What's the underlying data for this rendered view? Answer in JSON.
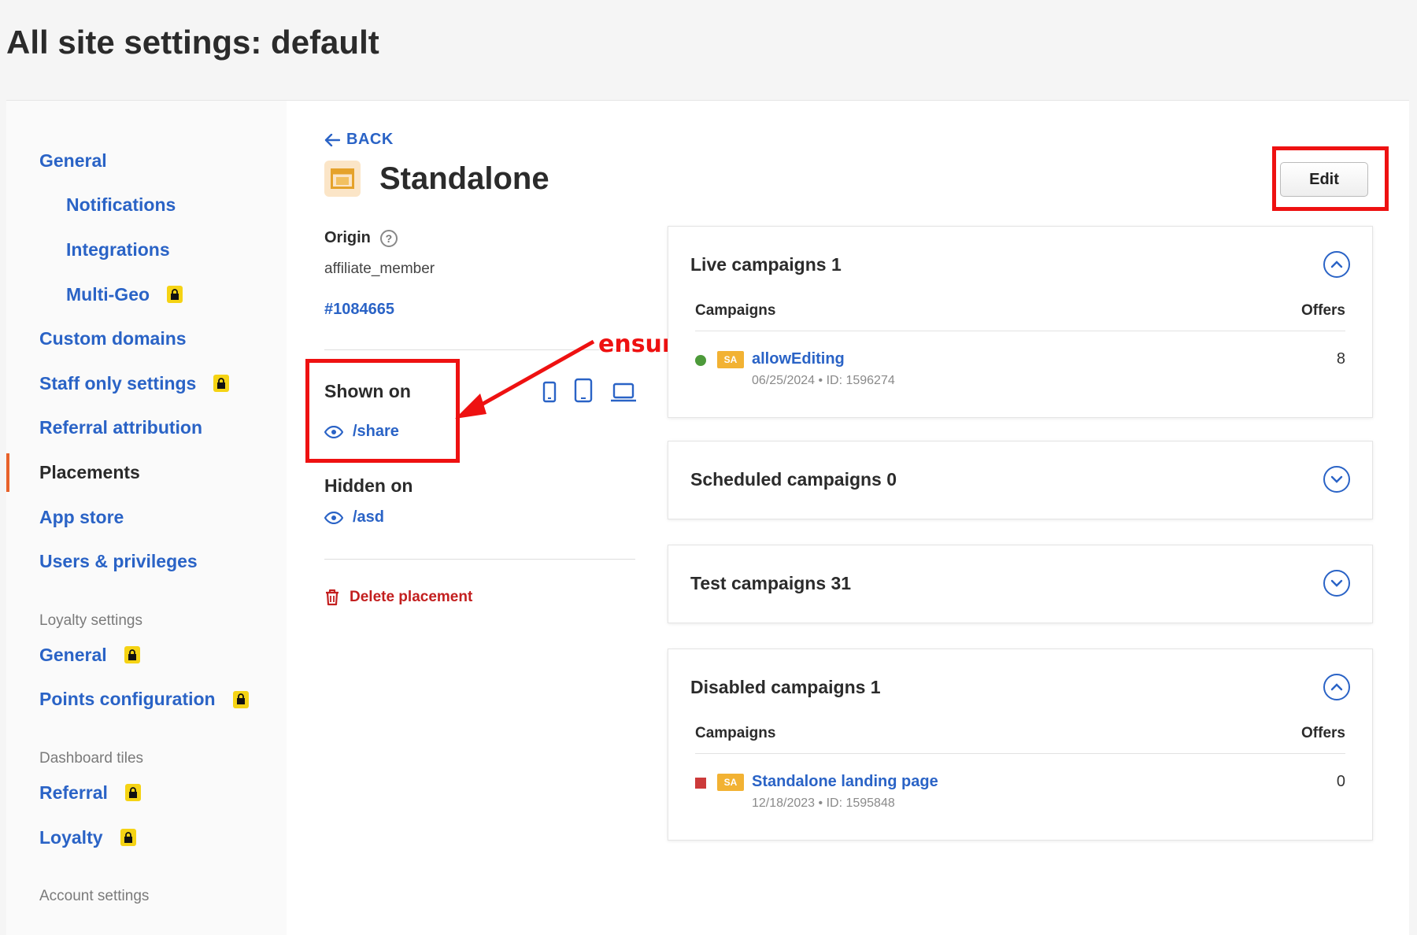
{
  "page": {
    "title": "All site settings: default"
  },
  "sidebar": {
    "items": [
      {
        "label": "General",
        "sub": false,
        "locked": false,
        "active": false
      },
      {
        "label": "Notifications",
        "sub": true,
        "locked": false,
        "active": false
      },
      {
        "label": "Integrations",
        "sub": true,
        "locked": false,
        "active": false
      },
      {
        "label": "Multi-Geo",
        "sub": true,
        "locked": true,
        "active": false
      },
      {
        "label": "Custom domains",
        "sub": false,
        "locked": false,
        "active": false
      },
      {
        "label": "Staff only settings",
        "sub": false,
        "locked": true,
        "active": false
      },
      {
        "label": "Referral attribution",
        "sub": false,
        "locked": false,
        "active": false
      },
      {
        "label": "Placements",
        "sub": false,
        "locked": false,
        "active": true
      },
      {
        "label": "App store",
        "sub": false,
        "locked": false,
        "active": false
      },
      {
        "label": "Users & privileges",
        "sub": false,
        "locked": false,
        "active": false
      }
    ],
    "loyalty_group": "Loyalty settings",
    "loyalty_items": [
      {
        "label": "General",
        "locked": true
      },
      {
        "label": "Points configuration",
        "locked": true
      }
    ],
    "dashboard_group": "Dashboard tiles",
    "dashboard_items": [
      {
        "label": "Referral",
        "locked": true
      },
      {
        "label": "Loyalty",
        "locked": true
      }
    ],
    "account_group": "Account settings"
  },
  "placement": {
    "back_label": "BACK",
    "name": "Standalone",
    "edit_label": "Edit",
    "origin_label": "Origin",
    "origin_value": "affiliate_member",
    "origin_id": "#1084665",
    "shown_on_label": "Shown on",
    "shown_on_path": "/share",
    "hidden_on_label": "Hidden on",
    "hidden_on_path": "/asd",
    "delete_label": "Delete placement"
  },
  "annotation": {
    "text": "ensure exact URL path matches",
    "color": "#ee1111"
  },
  "cards": [
    {
      "title": "Live campaigns 1",
      "expanded": true,
      "columns": [
        "Campaigns",
        "Offers"
      ],
      "rows": [
        {
          "status": "live",
          "status_color": "#4d9a3a",
          "badge": "SA",
          "name": "allowEditing",
          "meta": "06/25/2024 • ID: 1596274",
          "offers": "8"
        }
      ]
    },
    {
      "title": "Scheduled campaigns 0",
      "expanded": false,
      "columns": [],
      "rows": []
    },
    {
      "title": "Test campaigns 31",
      "expanded": false,
      "columns": [],
      "rows": []
    },
    {
      "title": "Disabled campaigns 1",
      "expanded": true,
      "columns": [
        "Campaigns",
        "Offers"
      ],
      "rows": [
        {
          "status": "disabled",
          "status_color": "#cc3a3a",
          "badge": "SA",
          "name": "Standalone landing page",
          "meta": "12/18/2023 • ID: 1595848",
          "offers": "0"
        }
      ]
    }
  ],
  "colors": {
    "link": "#2a63c6",
    "accent": "#e8622a",
    "danger": "#c31f1f",
    "lock": "#f5d314",
    "highlight": "#ee1111"
  }
}
